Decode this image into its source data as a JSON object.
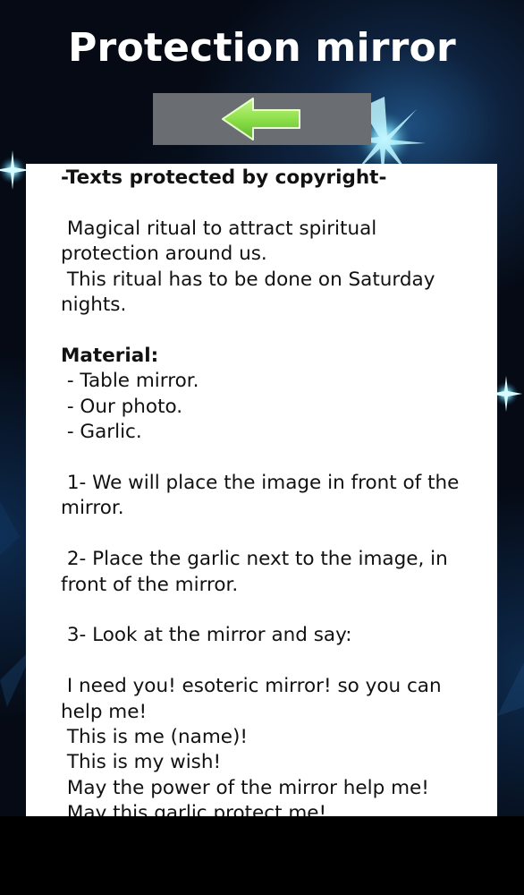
{
  "app": {
    "title": "Protection mirror"
  },
  "toolbar": {
    "back_icon": "left-arrow-icon",
    "back_color": "#8ee04a"
  },
  "content": {
    "copyright": "-Texts protected by copyright-",
    "intro_1": " Magical ritual to attract spiritual protection around us.",
    "intro_2": " This ritual has to be done on Saturday nights.",
    "material_heading": "Material:",
    "materials": [
      " - Table mirror.",
      " - Our photo.",
      " - Garlic."
    ],
    "steps": [
      " 1- We will place the image in front of the mirror.",
      " 2- Place the garlic next to the image, in front of the mirror.",
      " 3- Look at the mirror and say:"
    ],
    "chant": [
      " I need you! esoteric mirror! so you can help me!",
      " This is me (name)!",
      " This is my wish!",
      " May the power of the mirror help me!",
      " May this garlic protect me!"
    ]
  },
  "colors": {
    "background": "#050a14",
    "panel": "#ffffff",
    "button": "#6a6d72"
  }
}
